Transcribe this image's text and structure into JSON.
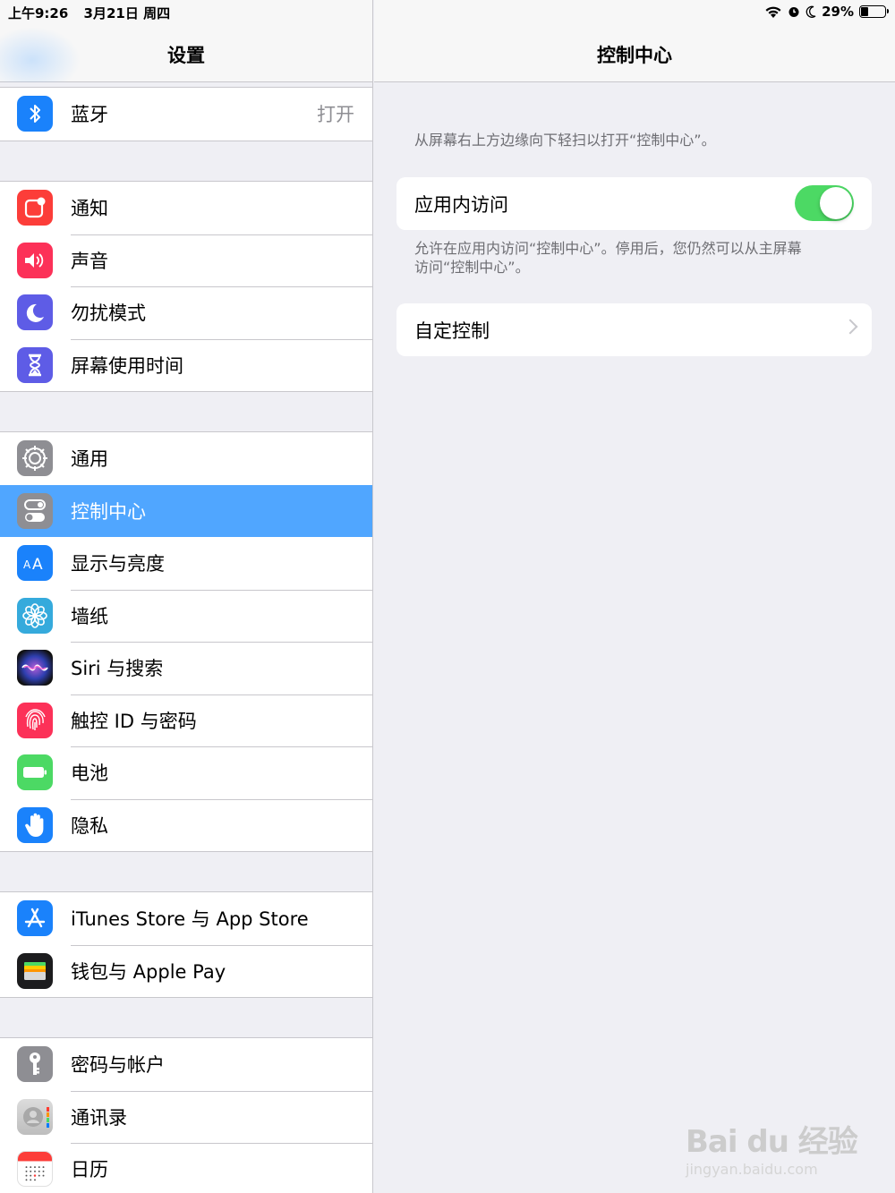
{
  "status": {
    "time": "上午9:26",
    "date": "3月21日 周四",
    "battery": "29%",
    "battery_level": 0.29
  },
  "master": {
    "title": "设置",
    "groups": [
      [
        {
          "label": "蓝牙",
          "value": "打开",
          "icon": "bluetooth-icon",
          "color": "#1a82fb"
        }
      ],
      [
        {
          "label": "通知",
          "icon": "notifications-icon",
          "color": "#fc3d39"
        },
        {
          "label": "声音",
          "icon": "sound-icon",
          "color": "#fc3158"
        },
        {
          "label": "勿扰模式",
          "icon": "moon-icon",
          "color": "#5e5ce6"
        },
        {
          "label": "屏幕使用时间",
          "icon": "hourglass-icon",
          "color": "#5e5ce6"
        }
      ],
      [
        {
          "label": "通用",
          "icon": "gear-icon",
          "color": "#8e8e93"
        },
        {
          "label": "控制中心",
          "icon": "toggles-icon",
          "color": "#8e8e93",
          "selected": true
        },
        {
          "label": "显示与亮度",
          "icon": "display-icon",
          "color": "#1a82fb"
        },
        {
          "label": "墙纸",
          "icon": "wallpaper-flower-icon",
          "color": "#35aadc"
        },
        {
          "label": "Siri 与搜索",
          "icon": "siri-icon",
          "color": "#1c1c3a"
        },
        {
          "label": "触控 ID 与密码",
          "icon": "fingerprint-icon",
          "color": "#fc3158"
        },
        {
          "label": "电池",
          "icon": "battery-icon",
          "color": "#4cd964"
        },
        {
          "label": "隐私",
          "icon": "hand-icon",
          "color": "#1a82fb"
        }
      ],
      [
        {
          "label": "iTunes Store 与 App Store",
          "icon": "app-store-icon",
          "color": "#1a82fb"
        },
        {
          "label": "钱包与 Apple Pay",
          "icon": "wallet-icon",
          "color": "#1c1c1e"
        }
      ],
      [
        {
          "label": "密码与帐户",
          "icon": "key-icon",
          "color": "#8e8e93"
        },
        {
          "label": "通讯录",
          "icon": "contacts-icon",
          "color": "#c7c7cc"
        },
        {
          "label": "日历",
          "icon": "calendar-icon",
          "color": "#ffffff"
        }
      ]
    ]
  },
  "detail": {
    "title": "控制中心",
    "top_note": "从屏幕右上方边缘向下轻扫以打开“控制中心”。",
    "access_label": "应用内访问",
    "access_enabled": true,
    "access_note_line1": "允许在应用内访问“控制中心”。停用后，您仍然可以从主屏幕",
    "access_note_line2": "访问“控制中心”。",
    "customize_label": "自定控制"
  },
  "watermark": {
    "main": "Bai du 经验",
    "sub": "jingyan.baidu.com"
  }
}
